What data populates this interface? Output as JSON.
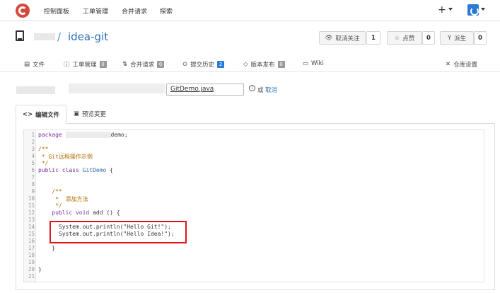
{
  "navbar": {
    "items": [
      "控制面板",
      "工单管理",
      "合并请求",
      "探索"
    ],
    "plus": "+"
  },
  "repo": {
    "sep": "/",
    "name": "idea-git",
    "unwatch_label": "取消关注",
    "unwatch_count": "1",
    "star_label": "点赞",
    "star_count": "0",
    "fork_label": "派生",
    "fork_count": "0"
  },
  "tabs": [
    {
      "label": "文件"
    },
    {
      "label": "工单管理",
      "badge": "0"
    },
    {
      "label": "合并请求",
      "badge": "0"
    },
    {
      "label": "提交历史",
      "badge": "2"
    },
    {
      "label": "版本发布",
      "badge": "0"
    },
    {
      "label": "Wiki"
    },
    {
      "label": "仓库设置"
    }
  ],
  "editor": {
    "path_sep": "/",
    "filename": "GitDemo.java",
    "or_text": "或",
    "cancel_link": "取消",
    "edit_tab": "编辑文件",
    "preview_tab": "预览变更"
  },
  "code": {
    "line_numbers": [
      "1",
      "2",
      "3",
      "4",
      "5",
      "6",
      "7",
      "8",
      "9",
      "10",
      "11",
      "12",
      "13",
      "14",
      "15",
      "16",
      "17",
      "18",
      "19",
      "20",
      "21"
    ],
    "l1_kw": "package",
    "l1_rest": "demo;",
    "l3": "/**",
    "l4": " * Git远程操作示例",
    "l5": " */",
    "l6_kw": "public class",
    "l6_cls": "GitDemo",
    "l6_rest": " {",
    "l9": "    /**",
    "l10": "     *  添加方法",
    "l11": "     */",
    "l12_kw": "    public void",
    "l12_rest": " add () {",
    "l14": "      System.out.println(\"Hello Git!\");",
    "l15": "      System.out.println(\"Hello Idea!\");",
    "l17": "    }",
    "l20": "}"
  },
  "colors": {
    "accent": "#2a6fb6",
    "logo": "#d6473b",
    "highlight": "#e0161b"
  }
}
